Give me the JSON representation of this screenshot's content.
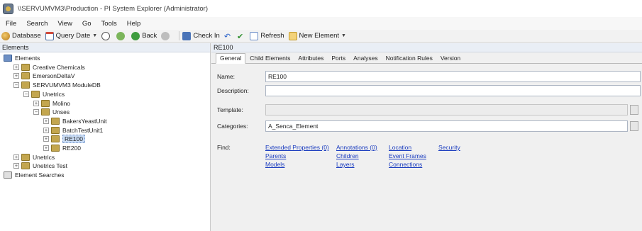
{
  "window": {
    "title": "\\\\SERVUMVM3\\Production - PI System Explorer (Administrator)"
  },
  "menu": [
    "File",
    "Search",
    "View",
    "Go",
    "Tools",
    "Help"
  ],
  "toolbar": {
    "database": "Database",
    "query_date": "Query Date",
    "back": "Back",
    "check_in": "Check In",
    "refresh": "Refresh",
    "new_element": "New Element"
  },
  "left": {
    "header": "Elements",
    "tree": [
      {
        "label": "Elements",
        "level": 0,
        "expander": "",
        "icon": "root"
      },
      {
        "label": "Creative Chemicals",
        "level": 1,
        "expander": "+",
        "icon": "el"
      },
      {
        "label": "EmersonDeltaV",
        "level": 1,
        "expander": "+",
        "icon": "el"
      },
      {
        "label": "SERVUMVM3 ModuleDB",
        "level": 1,
        "expander": "−",
        "icon": "el"
      },
      {
        "label": "Unetrics",
        "level": 2,
        "expander": "−",
        "icon": "el"
      },
      {
        "label": "Molino",
        "level": 3,
        "expander": "+",
        "icon": "el"
      },
      {
        "label": "Unses",
        "level": 3,
        "expander": "−",
        "icon": "el"
      },
      {
        "label": "BakersYeastUnit",
        "level": 4,
        "expander": "+",
        "icon": "el"
      },
      {
        "label": "BatchTestUnit1",
        "level": 4,
        "expander": "+",
        "icon": "el"
      },
      {
        "label": "RE100",
        "level": 4,
        "expander": "+",
        "icon": "el",
        "selected": true
      },
      {
        "label": "RE200",
        "level": 4,
        "expander": "+",
        "icon": "el"
      },
      {
        "label": "Unetrics",
        "level": 1,
        "expander": "+",
        "icon": "el"
      },
      {
        "label": "Unetrics Test",
        "level": 1,
        "expander": "+",
        "icon": "el"
      },
      {
        "label": "Element Searches",
        "level": 0,
        "expander": "",
        "icon": "search"
      }
    ]
  },
  "right": {
    "header": "RE100",
    "tabs": [
      "General",
      "Child Elements",
      "Attributes",
      "Ports",
      "Analyses",
      "Notification Rules",
      "Version"
    ],
    "active_tab": "General",
    "form": {
      "name_label": "Name:",
      "name_value": "RE100",
      "description_label": "Description:",
      "description_value": "",
      "template_label": "Template:",
      "template_value": "",
      "categories_label": "Categories:",
      "categories_value": "A_Senca_Element",
      "find_label": "Find:"
    },
    "find_links": [
      [
        "Extended Properties (0)",
        "Annotations (0)",
        "Location",
        "Security"
      ],
      [
        "Parents",
        "Children",
        "Event Frames"
      ],
      [
        "Models",
        "Layers",
        "Connections"
      ]
    ]
  },
  "colors": {
    "link": "#1a3cbf",
    "selection": "#c9dcf5",
    "pane_header": "#e9eef5"
  }
}
